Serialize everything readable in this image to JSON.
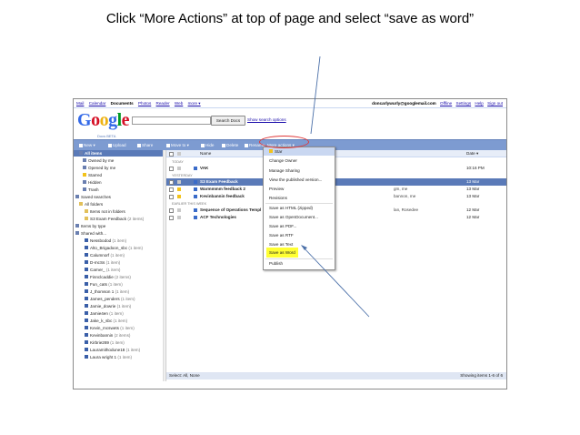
{
  "caption": "Click “More Actions” at top of page and select “save as word”",
  "topbar": {
    "links": [
      "Mail",
      "Calendar",
      "Documents",
      "Photos",
      "Reader",
      "Web",
      "more ▾"
    ],
    "active_link": "Documents",
    "account": [
      "doncarlywurly@googlemail.com",
      "Offline",
      "Settings",
      "Help",
      "Sign out"
    ]
  },
  "logo": {
    "text": "Google",
    "sub": "Docs BETA"
  },
  "search": {
    "button_label": "Search Docs",
    "options_link": "Show search options"
  },
  "toolbar": {
    "new": "New ▾",
    "upload": "Upload",
    "share": "Share",
    "move": "Move to ▾",
    "hide": "Hide",
    "delete": "Delete",
    "rename": "Rename",
    "more": "More actions ▾"
  },
  "sidebar": {
    "items": [
      {
        "label": "All items",
        "sub": ""
      },
      {
        "label": "Owned by me",
        "sub": ""
      },
      {
        "label": "Opened by me",
        "sub": ""
      },
      {
        "label": "Starred",
        "sub": ""
      },
      {
        "label": "Hidden",
        "sub": ""
      },
      {
        "label": "Trash",
        "sub": ""
      },
      {
        "label": "Saved searches",
        "sub": ""
      },
      {
        "label": "All folders",
        "sub": ""
      },
      {
        "label": "Items not in folders",
        "sub": ""
      },
      {
        "label": "S3 Exam Feedback",
        "sub": "(2 items)"
      },
      {
        "label": "Items by type",
        "sub": ""
      },
      {
        "label": "Shared with...",
        "sub": ""
      },
      {
        "label": "Nessbodod",
        "sub": "(1 item)"
      },
      {
        "label": "Alto_Brigadoon_sbc",
        "sub": "(1 item)"
      },
      {
        "label": "Calumnorf",
        "sub": "(1 item)"
      },
      {
        "label": "D-mcSs",
        "sub": "(1 item)"
      },
      {
        "label": "Carner_",
        "sub": "(1 item)"
      },
      {
        "label": "Finnclcaddie",
        "sub": "(2 items)"
      },
      {
        "label": "Fun_cats",
        "sub": "(1 item)"
      },
      {
        "label": "J_thomson 1",
        "sub": "(1 item)"
      },
      {
        "label": "James_penders",
        "sub": "(1 item)"
      },
      {
        "label": "Jamie_dowrie",
        "sub": "(1 item)"
      },
      {
        "label": "Jamie4en",
        "sub": "(1 item)"
      },
      {
        "label": "Jake_k_sbc",
        "sub": "(1 item)"
      },
      {
        "label": "Kevin_mcswets",
        "sub": "(1 item)"
      },
      {
        "label": "Kevinbannin",
        "sub": "(2 items)"
      },
      {
        "label": "Kirbrie269",
        "sub": "(1 item)"
      },
      {
        "label": "Lauramithodune18",
        "sub": "(1 item)"
      },
      {
        "label": "Laura wright 1",
        "sub": "(1 item)"
      }
    ]
  },
  "list": {
    "col_name": "Name",
    "col_date": "Date ▾",
    "groups": [
      "TODAY",
      "YESTERDAY",
      "EARLIER THIS WEEK"
    ],
    "rows": [
      {
        "name": "VAK",
        "owner": "",
        "date": "10:16 PM"
      },
      {
        "name": "S3 Exam Feedback",
        "owner": "",
        "date": "13 Mar"
      },
      {
        "name": "Warmmmm feedback 2",
        "owner": "gm, me",
        "date": "13 Mar"
      },
      {
        "name": "Kevinbannin feedback",
        "owner": "bannon, me",
        "date": "13 Mar"
      },
      {
        "name": "Sequence of Operations Templ",
        "owner": "lan, Rosedee",
        "date": "12 Mar"
      },
      {
        "name": "ACF Technologies",
        "owner": "",
        "date": "12 Mar"
      }
    ],
    "footer_left": "Select: All, None",
    "footer_right": "Showing items 1-6 of 6"
  },
  "menu": {
    "items": [
      "Star",
      "Change Owner",
      "Manage Sharing",
      "View the published version...",
      "Preview",
      "Revisions",
      "Save as HTML (zipped)",
      "Save as OpenDocument...",
      "Save as PDF...",
      "Save as RTF",
      "Save as Text",
      "Save as Word",
      "Publish"
    ],
    "highlighted": "Save as Word"
  },
  "colors": {
    "toolbar_blue": "#7d9bd1",
    "selection_blue": "#5a7ab8",
    "highlight_yellow": "#ffff33",
    "circle_red": "#e03a3a"
  }
}
